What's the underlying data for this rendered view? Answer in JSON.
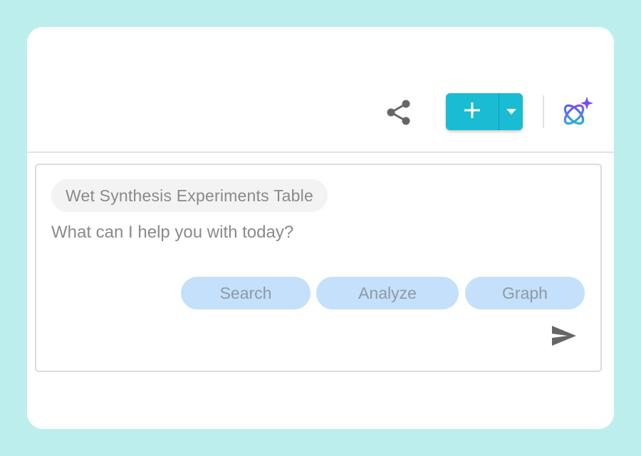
{
  "colors": {
    "background": "#bdeeee",
    "primary_button": "#19bcd3",
    "action_pill": "#c4e0fb",
    "icon_gray": "#666666"
  },
  "toolbar": {
    "share_icon": "share-icon",
    "add_icon": "plus-icon",
    "dropdown_icon": "caret-down-icon",
    "ai_icon": "ai-sparkle-atom-icon"
  },
  "chat": {
    "context_chip": "Wet Synthesis Experiments Table",
    "prompt_placeholder": "What can I help you with today?",
    "actions": [
      {
        "label": "Search"
      },
      {
        "label": "Analyze"
      },
      {
        "label": "Graph"
      }
    ],
    "send_icon": "send-icon"
  }
}
